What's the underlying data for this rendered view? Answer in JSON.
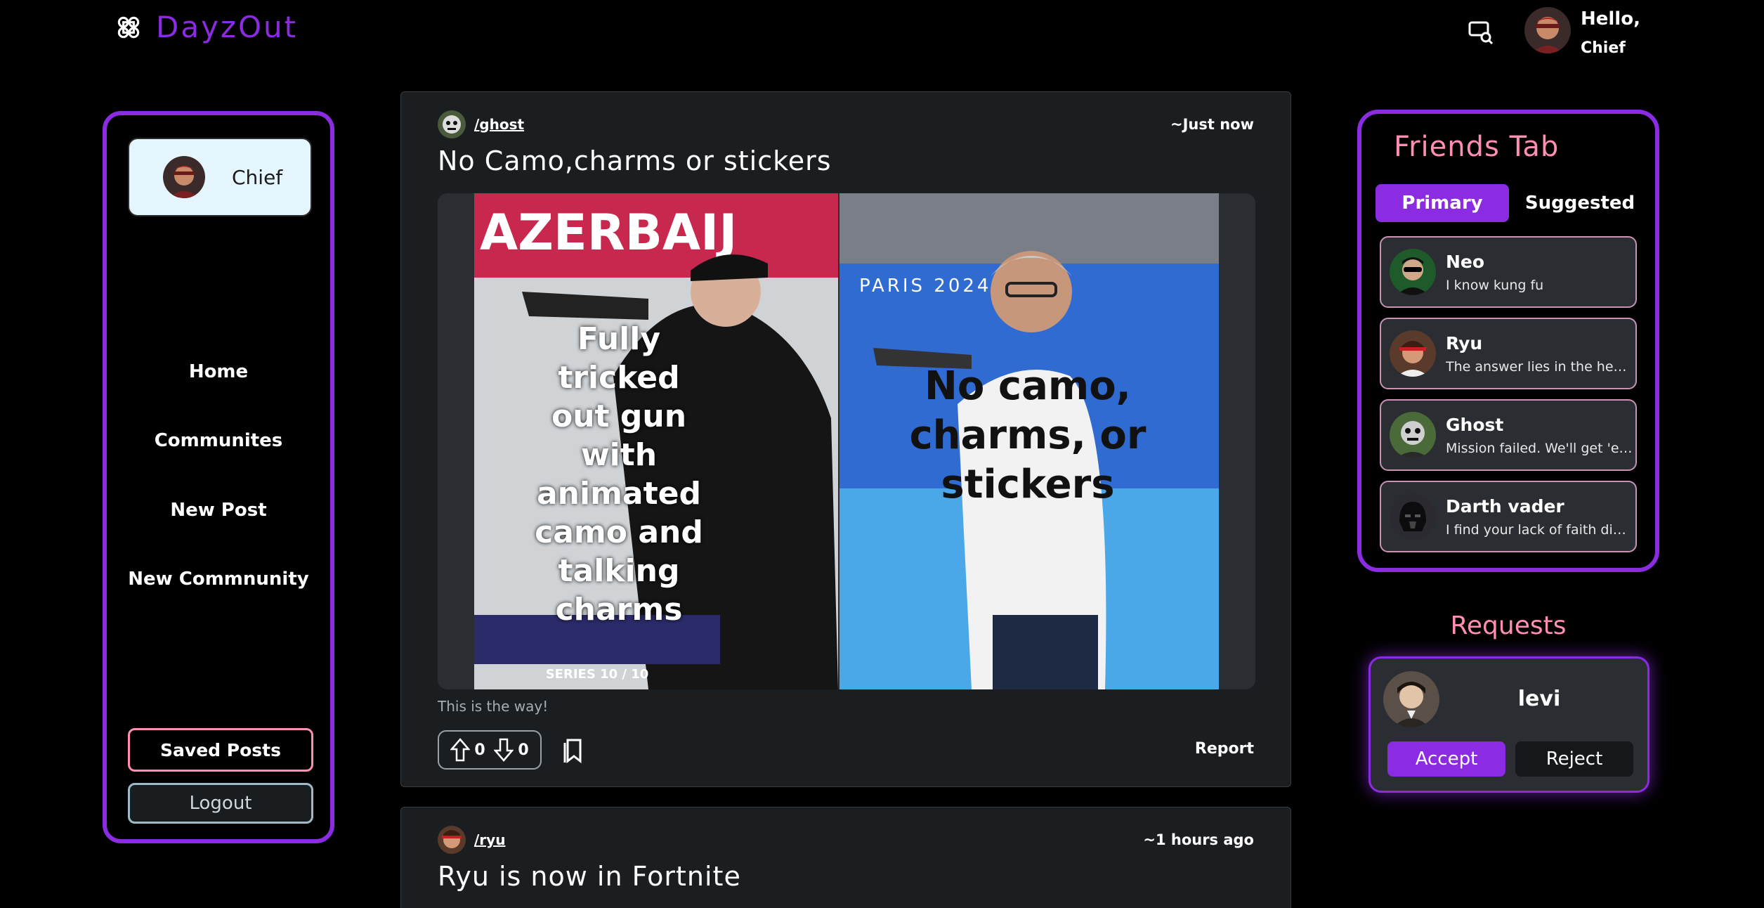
{
  "header": {
    "brand": "DayzOut",
    "greeting": "Hello,",
    "user": "Chief"
  },
  "sidebar": {
    "profile_name": "Chief",
    "nav": [
      "Home",
      "Communites",
      "New Post",
      "New Commnunity"
    ],
    "saved_label": "Saved Posts",
    "logout_label": "Logout"
  },
  "posts": [
    {
      "author": "/ghost",
      "time": "~Just now",
      "title": "No Camo,charms or stickers",
      "media_text_left": "Fully tricked out gun with animated camo and talking charms",
      "media_text_right": "No camo, charms, or stickers",
      "media_banner_left": "AZERBAIJ",
      "media_banner_right": "PARIS 2024",
      "media_series": "SERIES 10 / 10",
      "caption": "This is the way!",
      "upvotes": "0",
      "downvotes": "0",
      "report_label": "Report"
    },
    {
      "author": "/ryu",
      "time": "~1 hours ago",
      "title": "Ryu is now in Fortnite"
    }
  ],
  "friends": {
    "title": "Friends Tab",
    "tabs": [
      "Primary",
      "Suggested"
    ],
    "list": [
      {
        "name": "Neo",
        "status": "I know kung fu"
      },
      {
        "name": "Ryu",
        "status": "The answer lies in the heart ..."
      },
      {
        "name": "Ghost",
        "status": "Mission failed. We'll get 'em..."
      },
      {
        "name": "Darth vader",
        "status": "I find your lack of faith dist..."
      }
    ]
  },
  "requests": {
    "title": "Requests",
    "name": "levi",
    "accept_label": "Accept",
    "reject_label": "Reject"
  },
  "colors": {
    "accent": "#8b2be2",
    "pink": "#ff8fb2",
    "card": "#1b1e21"
  }
}
